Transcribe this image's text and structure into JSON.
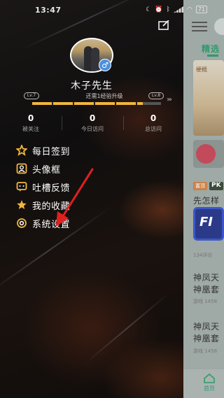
{
  "status_bar": {
    "time": "13:47",
    "battery": "71"
  },
  "profile": {
    "username": "木子先生",
    "level_text": "还需1经验升级",
    "level_badges": [
      "Lv.7",
      "Lv.8"
    ],
    "level_progress": 0.86,
    "gender_symbol": "♂"
  },
  "stats": [
    {
      "value": "0",
      "label": "被关注"
    },
    {
      "value": "0",
      "label": "今日访问"
    },
    {
      "value": "0",
      "label": "总访问"
    }
  ],
  "menu": [
    {
      "label": "每日签到",
      "icon": "sign-in-icon"
    },
    {
      "label": "头像框",
      "icon": "avatar-frame-icon"
    },
    {
      "label": "吐槽反馈",
      "icon": "feedback-icon"
    },
    {
      "label": "我的收藏",
      "icon": "star-icon"
    },
    {
      "label": "系统设置",
      "icon": "settings-icon"
    }
  ],
  "peek": {
    "tab": "精选",
    "banner_text": "梗概",
    "tag1": "置顶",
    "tag2": "PK",
    "item1_title": "先怎样",
    "blue_card_text": "FI",
    "item2_meta": "134评论",
    "item3_title_a": "神凤天",
    "item3_title_b": "神凰套",
    "item3_meta": "游戏 1458",
    "item4_title_a": "神凤天",
    "item4_title_b": "神凰套",
    "item4_meta": "游戏 1458",
    "nav_label": "首页"
  },
  "colors": {
    "accent_green": "#2f9a6b",
    "level_bar": "#f2b63c",
    "annotation_arrow": "#e02020"
  }
}
